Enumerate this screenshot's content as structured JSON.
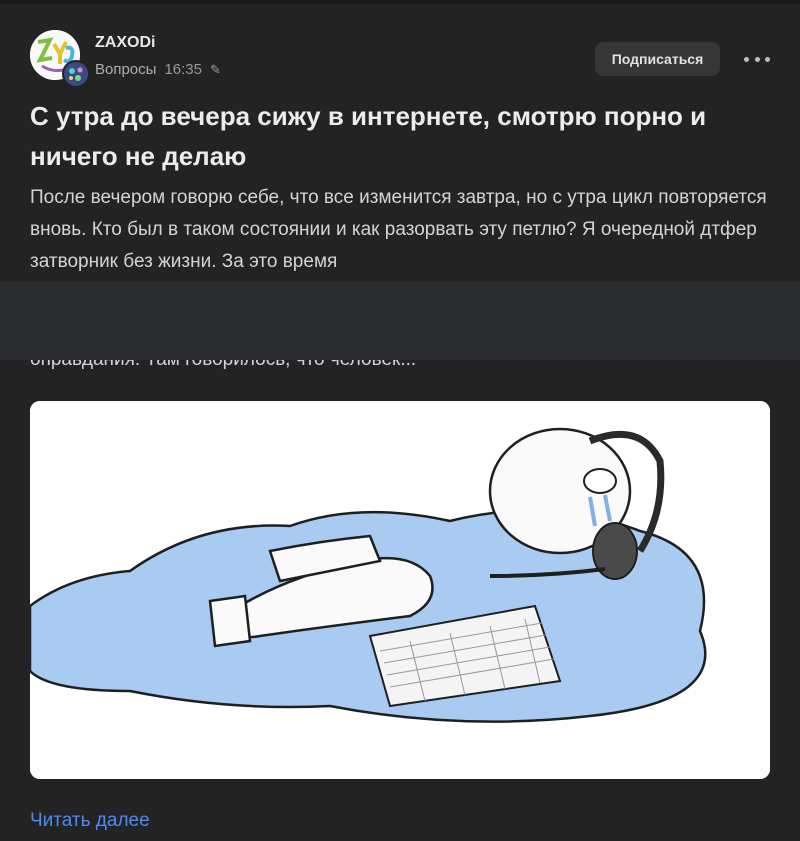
{
  "post": {
    "author": "ZAXODi",
    "category": "Вопросы",
    "time": "16:35",
    "subscribe_label": "Подписаться",
    "title": "С утра до вечера сижу в интернете, смотрю порно и ничего не делаю",
    "text": "После вечером говорю себе, что все изменится завтра, но с утра цикл повторяется вновь. Кто был в таком состоянии и как разорвать эту петлю? Я очередной дтфер затворник без жизни. За это время",
    "text_cut": "оправдания. Там говорилось, что человек...",
    "read_more": "Читать далее"
  },
  "icons": {
    "pencil": "pencil-icon",
    "more": "more-horizontal-icon"
  },
  "colors": {
    "background": "#1b1b1b",
    "card": "#232323",
    "link": "#4a8bf5",
    "button": "#363636"
  }
}
